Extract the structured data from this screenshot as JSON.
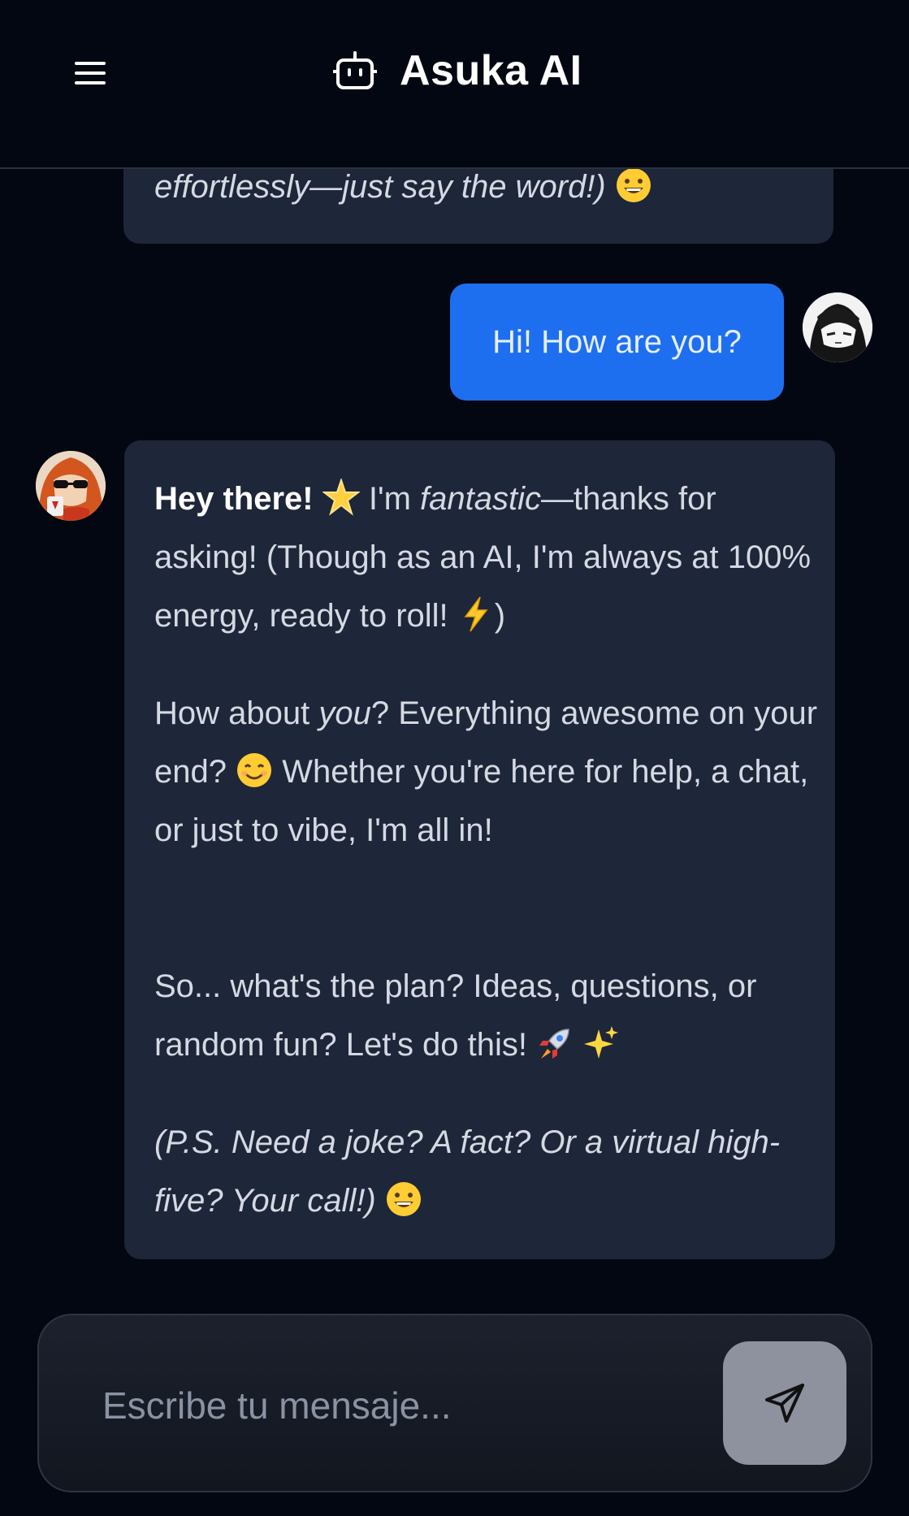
{
  "header": {
    "title": "Asuka AI",
    "menu_icon": "hamburger-menu-icon",
    "brand_icon": "robot-icon"
  },
  "messages": [
    {
      "role": "assistant",
      "partial": true,
      "text": "effortlessly—just say the word!)",
      "emoji": "grinning-face"
    },
    {
      "role": "user",
      "text": "Hi! How are you?"
    },
    {
      "role": "assistant",
      "p1": {
        "bold": "Hey there!",
        "emoji1": "glowing-star",
        "t1": " I'm ",
        "italic": "fantastic",
        "t2": "—thanks for asking! (Though as an AI, I'm always at 100% energy, ready to roll! ",
        "emoji2": "high-voltage",
        "t3": ")"
      },
      "p2": {
        "t1": "How about ",
        "italic": "you",
        "t2": "? Everything awesome on your end? ",
        "emoji": "smiling-face",
        "t3": " Whether you're here for help, a chat, or just to vibe, I'm all in!"
      },
      "p3": {
        "t1": "So... what's the plan? Ideas, questions, or random fun? Let's do this! ",
        "emoji1": "rocket",
        "emoji2": "sparkles"
      },
      "p4": {
        "italic": "(P.S. Need a joke? A fact? Or a virtual high-five? Your call!)",
        "emoji": "grinning-face"
      }
    }
  ],
  "composer": {
    "placeholder": "Escribe tu mensaje...",
    "send_icon": "send-icon"
  },
  "colors": {
    "background": "#030711",
    "assistant_bubble": "#1e2639",
    "user_bubble": "#1d6ff0",
    "send_button": "#8d929e"
  }
}
